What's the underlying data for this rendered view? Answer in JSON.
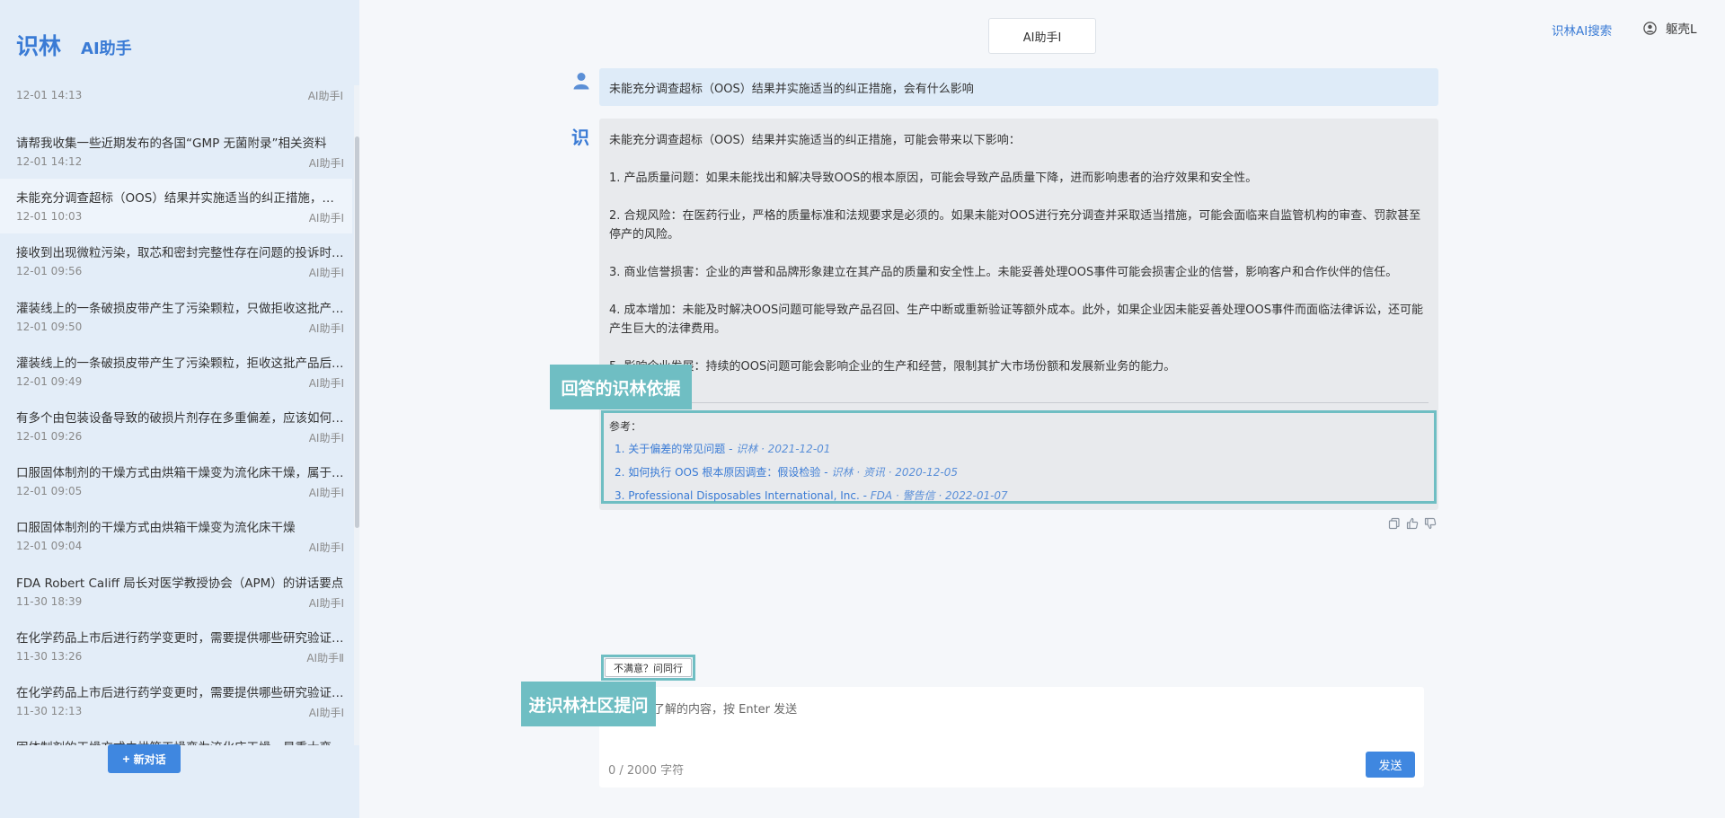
{
  "brand": {
    "name": "识林",
    "sub": "AI助手"
  },
  "history": {
    "top": {
      "time": "12-01 14:13",
      "tag": "AI助手Ⅰ"
    },
    "items": [
      {
        "title": "请帮我收集一些近期发布的各国“GMP 无菌附录”相关资料",
        "time": "12-01 14:12",
        "tag": "AI助手Ⅰ"
      },
      {
        "title": "未能充分调查超标（OOS）结果并实施适当的纠正措施，会有什么影响",
        "time": "12-01 10:03",
        "tag": "AI助手Ⅰ"
      },
      {
        "title": "接收到出现微粒污染，取芯和密封完整性存在问题的投诉时应如何处理",
        "time": "12-01 09:56",
        "tag": "AI助手Ⅰ"
      },
      {
        "title": "灌装线上的一条破损皮带产生了污染颗粒，只做拒收这批产品是否足够",
        "time": "12-01 09:50",
        "tag": "AI助手Ⅰ"
      },
      {
        "title": "灌装线上的一条破损皮带产生了污染颗粒，拒收这批产品后还需要做什么",
        "time": "12-01 09:49",
        "tag": "AI助手Ⅰ"
      },
      {
        "title": "有多个由包装设备导致的破损片剂存在多重偏差，应该如何处理",
        "time": "12-01 09:26",
        "tag": "AI助手Ⅰ"
      },
      {
        "title": "口服固体制剂的干燥方式由烘箱干燥变为流化床干燥，属于什么变更",
        "time": "12-01 09:05",
        "tag": "AI助手Ⅰ"
      },
      {
        "title": "口服固体制剂的干燥方式由烘箱干燥变为流化床干燥",
        "time": "12-01 09:04",
        "tag": "AI助手Ⅰ"
      },
      {
        "title": "FDA Robert Califf 局长对医学教授协会（APM）的讲话要点",
        "time": "11-30 18:39",
        "tag": "AI助手Ⅰ"
      },
      {
        "title": "在化学药品上市后进行药学变更时，需要提供哪些研究验证资料",
        "time": "11-30 13:26",
        "tag": "AI助手Ⅱ"
      },
      {
        "title": "在化学药品上市后进行药学变更时，需要提供哪些研究验证资料？",
        "time": "11-30 12:13",
        "tag": "AI助手Ⅰ"
      },
      {
        "title": "固体制剂的干燥方式由烘箱干燥变为流化床干燥，是重大变更吗",
        "time": "",
        "tag": ""
      }
    ],
    "active_index": 1
  },
  "new_chat_label": "新对话",
  "model_tab": "AI助手Ⅰ",
  "top_link": "识林AI搜索",
  "user_name": "躯壳L",
  "question": "未能充分调查超标（OOS）结果并实施适当的纠正措施，会有什么影响",
  "bot_avatar": "识",
  "answer": {
    "intro": "未能充分调查超标（OOS）结果并实施适当的纠正措施，可能会带来以下影响：",
    "p1": "1. 产品质量问题：如果未能找出和解决导致OOS的根本原因，可能会导致产品质量下降，进而影响患者的治疗效果和安全性。",
    "p2": "2. 合规风险：在医药行业，严格的质量标准和法规要求是必须的。如果未能对OOS进行充分调查并采取适当措施，可能会面临来自监管机构的审查、罚款甚至停产的风险。",
    "p3": "3. 商业信誉损害：企业的声誉和品牌形象建立在其产品的质量和安全性上。未能妥善处理OOS事件可能会损害企业的信誉，影响客户和合作伙伴的信任。",
    "p4": "4. 成本增加：未能及时解决OOS问题可能导致产品召回、生产中断或重新验证等额外成本。此外，如果企业因未能妥善处理OOS事件而面临法律诉讼，还可能产生巨大的法律费用。",
    "p5": "5. 影响企业发展：持续的OOS问题可能会影响企业的生产和经营，限制其扩大市场份额和发展新业务的能力。"
  },
  "refs": {
    "title": "参考：",
    "items": [
      {
        "text": "1. 关于偏差的常见问题 - ",
        "src": "识林 · 2021-12-01"
      },
      {
        "text": "2. 如何执行 OOS 根本原因调查：假设检验 - ",
        "src": "识林 · 资讯 · 2020-12-05"
      },
      {
        "text": "3. Professional Disposables International, Inc. - ",
        "src": "FDA · 警告信 · 2022-01-07"
      }
    ]
  },
  "annotations": {
    "refs": "回答的识林依据",
    "community": "进识林社区提问"
  },
  "ask_peer_label": "不满意？问同行",
  "input": {
    "placeholder": "了解的内容，按 Enter 发送",
    "count": "0 / 2000 字符",
    "send_label": "发送"
  },
  "colors": {
    "accent": "#3a7bd5",
    "annotation": "#6fbec3",
    "sidebar_bg": "#e3edf8"
  }
}
